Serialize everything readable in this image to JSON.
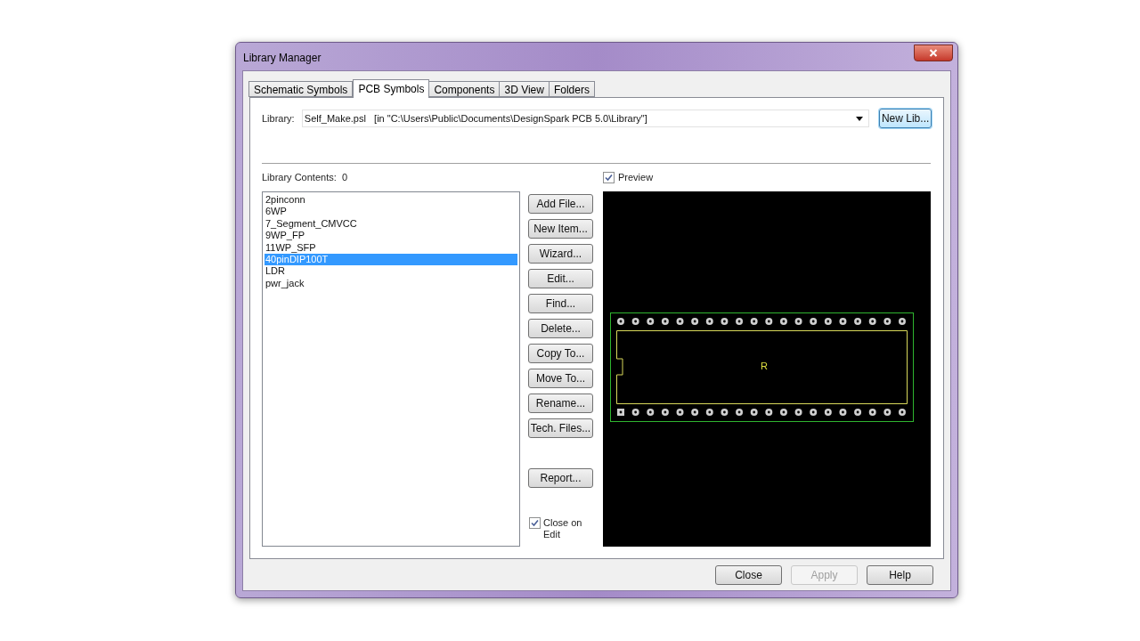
{
  "window": {
    "title": "Library Manager"
  },
  "tabs": [
    {
      "label": "Schematic Symbols",
      "selected": false
    },
    {
      "label": "PCB Symbols",
      "selected": true
    },
    {
      "label": "Components",
      "selected": false
    },
    {
      "label": "3D View",
      "selected": false
    },
    {
      "label": "Folders",
      "selected": false
    }
  ],
  "library": {
    "label": "Library:",
    "value": "Self_Make.psl   [in \"C:\\Users\\Public\\Documents\\DesignSpark PCB 5.0\\Library\"]",
    "new_button": "New Lib..."
  },
  "contents": {
    "label": "Library Contents:",
    "count": "0"
  },
  "preview": {
    "label": "Preview",
    "checked": true,
    "reference": "R"
  },
  "items": [
    {
      "name": "2pinconn",
      "selected": false
    },
    {
      "name": "6WP",
      "selected": false
    },
    {
      "name": "7_Segment_CMVCC",
      "selected": false
    },
    {
      "name": "9WP_FP",
      "selected": false
    },
    {
      "name": "11WP_SFP",
      "selected": false
    },
    {
      "name": "40pinDIP100T",
      "selected": true
    },
    {
      "name": "LDR",
      "selected": false
    },
    {
      "name": "pwr_jack",
      "selected": false
    }
  ],
  "actions": [
    "Add File...",
    "New Item...",
    "Wizard...",
    "Edit...",
    "Find...",
    "Delete...",
    "Copy To...",
    "Move To...",
    "Rename...",
    "Tech. Files..."
  ],
  "report_button": "Report...",
  "close_on_edit": {
    "label": "Close on Edit",
    "checked": true
  },
  "footer_buttons": [
    {
      "label": "Close",
      "disabled": false
    },
    {
      "label": "Apply",
      "disabled": true
    },
    {
      "label": "Help",
      "disabled": false
    }
  ]
}
